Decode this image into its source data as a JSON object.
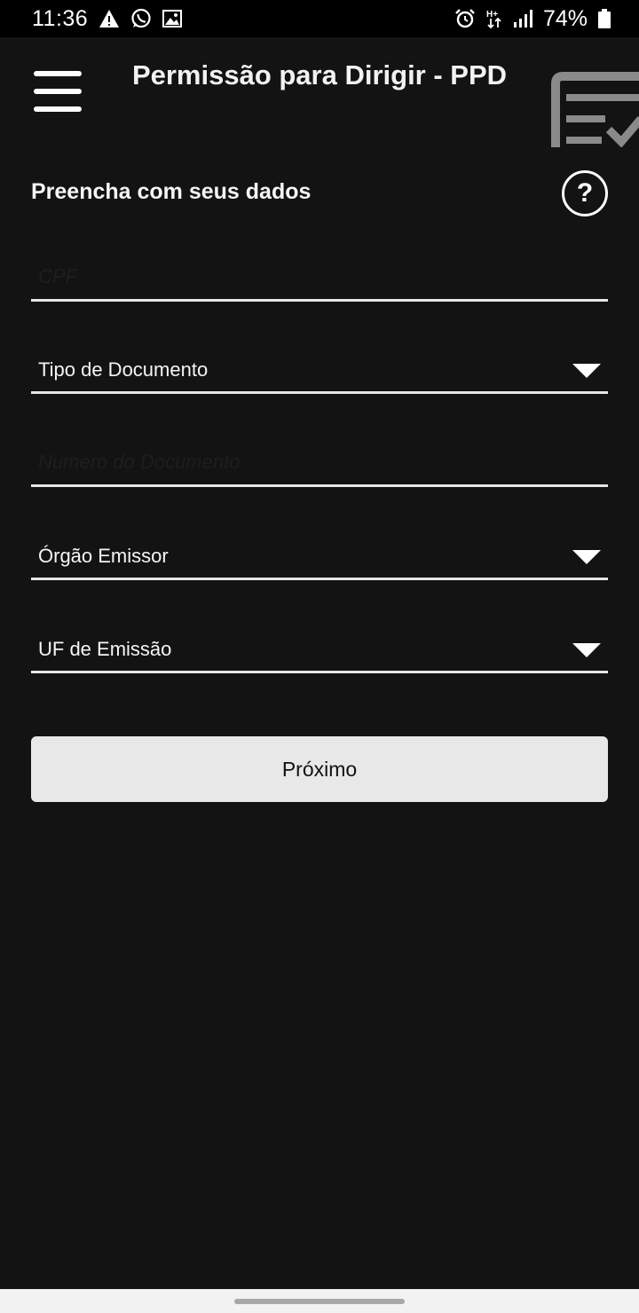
{
  "status_bar": {
    "time": "11:36",
    "left_icons": [
      "warning-icon",
      "whatsapp-icon",
      "image-icon"
    ],
    "right_icons": [
      "alarm-icon",
      "data-arrows-icon",
      "signal-icon",
      "battery-icon"
    ],
    "battery_percent": "74%"
  },
  "header": {
    "title": "Permissão para Dirigir - PPD",
    "menu_icon": "hamburger-menu-icon",
    "badge_icon": "document-check-icon"
  },
  "form": {
    "heading": "Preencha com seus dados",
    "help_symbol": "?",
    "cpf": {
      "placeholder": "CPF",
      "value": ""
    },
    "document_type": {
      "label": "Tipo de Documento"
    },
    "document_number": {
      "placeholder": "Numero do Documento",
      "value": ""
    },
    "issuing_body": {
      "label": "Órgão Emissor"
    },
    "issuing_state": {
      "label": "UF de Emissão"
    },
    "next_button": "Próximo"
  },
  "colors": {
    "background": "#131313",
    "status_bar": "#000000",
    "text": "#ffffff",
    "button": "#e8e8e8",
    "button_text": "#111111"
  }
}
